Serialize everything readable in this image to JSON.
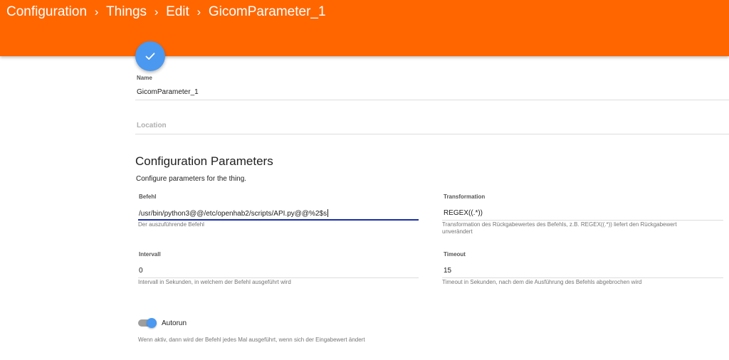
{
  "header": {
    "breadcrumbs": [
      "Configuration",
      "Things",
      "Edit",
      "GicomParameter_1"
    ],
    "separator": "›",
    "color": "#ff6600"
  },
  "save_fab": {
    "icon": "checkmark-icon",
    "color": "#4a98f0"
  },
  "name_field": {
    "label": "Name",
    "value": "GicomParameter_1"
  },
  "location_field": {
    "placeholder": "Location",
    "value": ""
  },
  "config": {
    "title": "Configuration Parameters",
    "subtitle": "Configure parameters for the thing.",
    "befehl": {
      "label": "Befehl",
      "value": "/usr/bin/python3@@/etc/openhab2/scripts/API.py@@%2$s",
      "hint": "Der auszuführende Befehl"
    },
    "transformation": {
      "label": "Transformation",
      "value": "REGEX((.*))",
      "hint_line1": "Transformation des Rückgabewertes des Befehls, z.B. REGEX((.*)) liefert den Rückgabewert",
      "hint_line2": "unverändert"
    },
    "intervall": {
      "label": "Intervall",
      "value": "0",
      "hint": "Intervall in Sekunden, in welchem der Befehl ausgeführt wird"
    },
    "timeout": {
      "label": "Timeout",
      "value": "15",
      "hint": "Timeout in Sekunden, nach dem die Ausführung des Befehls abgebrochen wird"
    },
    "autorun": {
      "label": "Autorun",
      "checked": true,
      "hint": "Wenn aktiv, dann wird der Befehl jedes Mal ausgeführt, wenn sich der Eingabewert ändert"
    }
  }
}
